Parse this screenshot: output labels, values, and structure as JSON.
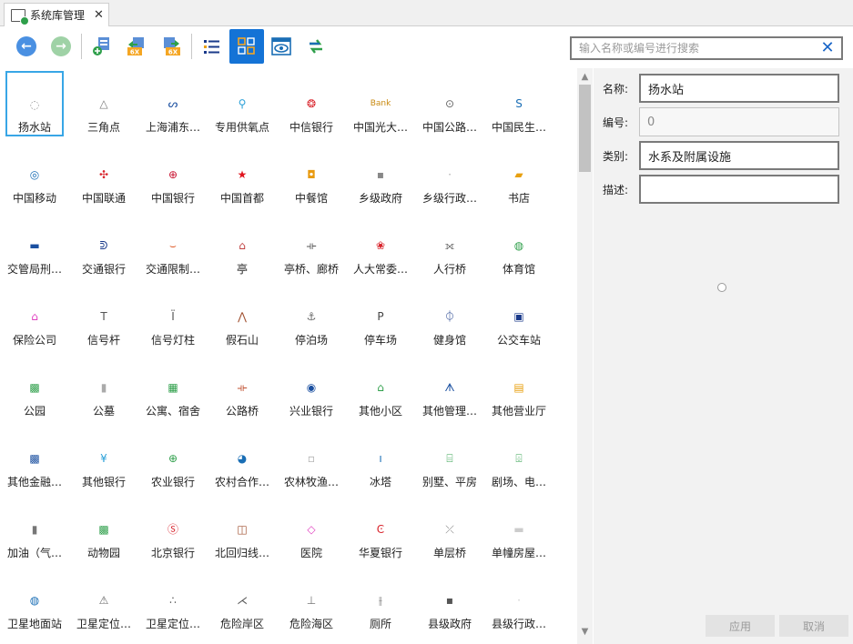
{
  "tab": {
    "label": "系统库管理",
    "close": "✕"
  },
  "toolbar": {
    "buttons": [
      {
        "name": "back-button",
        "icon": "arrow-left-circle-icon",
        "active": false
      },
      {
        "name": "forward-button",
        "icon": "arrow-right-circle-icon",
        "active": false
      },
      {
        "name": "import-button",
        "icon": "import-icon",
        "active": false
      },
      {
        "name": "export-6x-button",
        "icon": "export-6x-icon",
        "text": "6X",
        "active": false
      },
      {
        "name": "import-6x-button",
        "icon": "import-6x-icon",
        "text": "6X",
        "active": false
      },
      {
        "name": "list-view-button",
        "icon": "list-view-icon",
        "active": false
      },
      {
        "name": "icon-view-button",
        "icon": "icon-view-icon",
        "active": true
      },
      {
        "name": "preview-button",
        "icon": "eye-window-icon",
        "active": false
      },
      {
        "name": "refresh-button",
        "icon": "swap-arrows-icon",
        "active": false
      }
    ],
    "accent": "#1473d6"
  },
  "search": {
    "placeholder": "输入名称或编号进行搜索",
    "value": "",
    "clear_icon": "✕"
  },
  "grid": {
    "selected_index": 0,
    "items": [
      {
        "label": "扬水站",
        "glyph": "◌",
        "color": "#9a9a9a"
      },
      {
        "label": "三角点",
        "glyph": "△",
        "color": "#7a7a7a"
      },
      {
        "label": "上海浦东…",
        "glyph": "ᔕ",
        "color": "#1a4fa0"
      },
      {
        "label": "专用供氧点",
        "glyph": "⚲",
        "color": "#2aa0d8"
      },
      {
        "label": "中信银行",
        "glyph": "❂",
        "color": "#d8222a"
      },
      {
        "label": "中国光大…",
        "glyph": "Bank",
        "color": "#c98a10"
      },
      {
        "label": "中国公路…",
        "glyph": "⊙",
        "color": "#666666"
      },
      {
        "label": "中国民生…",
        "glyph": "S",
        "color": "#1a6eb5"
      },
      {
        "label": "中国移动",
        "glyph": "◎",
        "color": "#1a6eb5"
      },
      {
        "label": "中国联通",
        "glyph": "✣",
        "color": "#d8222a"
      },
      {
        "label": "中国银行",
        "glyph": "⊕",
        "color": "#c8102e"
      },
      {
        "label": "中国首都",
        "glyph": "★",
        "color": "#e0141e"
      },
      {
        "label": "中餐馆",
        "glyph": "◘",
        "color": "#e89a10"
      },
      {
        "label": "乡级政府",
        "glyph": "▪",
        "color": "#888888"
      },
      {
        "label": "乡级行政…",
        "glyph": "·",
        "color": "#aaaaaa"
      },
      {
        "label": "书店",
        "glyph": "▰",
        "color": "#e8a010"
      },
      {
        "label": "交管局刑…",
        "glyph": "▬",
        "color": "#1a4fa0"
      },
      {
        "label": "交通银行",
        "glyph": "ᕲ",
        "color": "#1a3a8a"
      },
      {
        "label": "交通限制…",
        "glyph": "⌣",
        "color": "#e06030"
      },
      {
        "label": "亭",
        "glyph": "⌂",
        "color": "#c04040"
      },
      {
        "label": "亭桥、廊桥",
        "glyph": "⟛",
        "color": "#555555"
      },
      {
        "label": "人大常委…",
        "glyph": "❀",
        "color": "#d8222a"
      },
      {
        "label": "人行桥",
        "glyph": "⟗",
        "color": "#555555"
      },
      {
        "label": "体育馆",
        "glyph": "◍",
        "color": "#2e9f4a"
      },
      {
        "label": "保险公司",
        "glyph": "⌂",
        "color": "#e040c0"
      },
      {
        "label": "信号杆",
        "glyph": "T",
        "color": "#555555"
      },
      {
        "label": "信号灯柱",
        "glyph": "Ï",
        "color": "#555555"
      },
      {
        "label": "假石山",
        "glyph": "⋀",
        "color": "#a05030"
      },
      {
        "label": "停泊场",
        "glyph": "⚓",
        "color": "#666666"
      },
      {
        "label": "停车场",
        "glyph": "P",
        "color": "#444444"
      },
      {
        "label": "健身馆",
        "glyph": "⏀",
        "color": "#1a3a8a"
      },
      {
        "label": "公交车站",
        "glyph": "▣",
        "color": "#1a3a8a"
      },
      {
        "label": "公园",
        "glyph": "▩",
        "color": "#2e9f4a"
      },
      {
        "label": "公墓",
        "glyph": "▮",
        "color": "#aaaaaa"
      },
      {
        "label": "公寓、宿舍",
        "glyph": "▦",
        "color": "#2e9f4a"
      },
      {
        "label": "公路桥",
        "glyph": "⟛",
        "color": "#c05030"
      },
      {
        "label": "兴业银行",
        "glyph": "◉",
        "color": "#1a4fa0"
      },
      {
        "label": "其他小区",
        "glyph": "⌂",
        "color": "#2e9f4a"
      },
      {
        "label": "其他管理…",
        "glyph": "ᗑ",
        "color": "#1a4fa0"
      },
      {
        "label": "其他营业厅",
        "glyph": "▤",
        "color": "#e8a010"
      },
      {
        "label": "其他金融…",
        "glyph": "▩",
        "color": "#1a4fa0"
      },
      {
        "label": "其他银行",
        "glyph": "¥",
        "color": "#2aa0d8"
      },
      {
        "label": "农业银行",
        "glyph": "⊕",
        "color": "#2e9f4a"
      },
      {
        "label": "农村合作…",
        "glyph": "◕",
        "color": "#1a6eb5"
      },
      {
        "label": "农林牧渔…",
        "glyph": "▫",
        "color": "#aaaaaa"
      },
      {
        "label": "冰塔",
        "glyph": "ı",
        "color": "#1a6eb5"
      },
      {
        "label": "别墅、平房",
        "glyph": "⌸",
        "color": "#2e9f4a"
      },
      {
        "label": "剧场、电…",
        "glyph": "⌹",
        "color": "#2e9f4a"
      },
      {
        "label": "加油（气…",
        "glyph": "▮",
        "color": "#777777"
      },
      {
        "label": "动物园",
        "glyph": "▩",
        "color": "#2e9f4a"
      },
      {
        "label": "北京银行",
        "glyph": "Ⓢ",
        "color": "#d8222a"
      },
      {
        "label": "北回归线…",
        "glyph": "◫",
        "color": "#a05030"
      },
      {
        "label": "医院",
        "glyph": "◇",
        "color": "#e040c0"
      },
      {
        "label": "华夏银行",
        "glyph": "Ͼ",
        "color": "#d8222a"
      },
      {
        "label": "单层桥",
        "glyph": "⤫",
        "color": "#888888"
      },
      {
        "label": "单幢房屋…",
        "glyph": "▬",
        "color": "#cccccc"
      },
      {
        "label": "卫星地面站",
        "glyph": "◍",
        "color": "#1a6eb5"
      },
      {
        "label": "卫星定位…",
        "glyph": "⚠",
        "color": "#666666"
      },
      {
        "label": "卫星定位…",
        "glyph": "∴",
        "color": "#555555"
      },
      {
        "label": "危险岸区",
        "glyph": "⋌",
        "color": "#555555"
      },
      {
        "label": "危险海区",
        "glyph": "⊥",
        "color": "#777777"
      },
      {
        "label": "厕所",
        "glyph": "⫲",
        "color": "#777777"
      },
      {
        "label": "县级政府",
        "glyph": "▪",
        "color": "#555555"
      },
      {
        "label": "县级行政…",
        "glyph": "·",
        "color": "#cccccc"
      }
    ]
  },
  "properties": {
    "name_label": "名称:",
    "name_value": "扬水站",
    "code_label": "编号:",
    "code_value": "0",
    "category_label": "类别:",
    "category_value": "水系及附属设施",
    "desc_label": "描述:",
    "desc_value": "",
    "preview_icon": "circle-icon",
    "apply_label": "应用",
    "cancel_label": "取消"
  }
}
